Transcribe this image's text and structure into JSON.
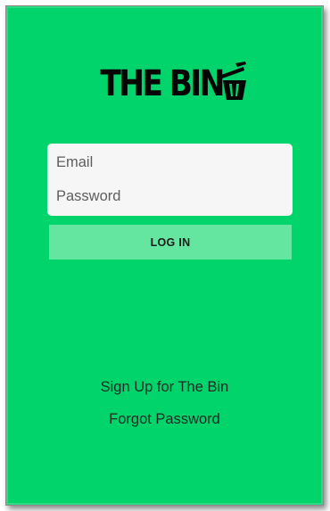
{
  "logo": {
    "text": "THE BIN",
    "icon": "trash-bin-icon"
  },
  "login_form": {
    "email_placeholder": "Email",
    "email_value": "",
    "password_placeholder": "Password",
    "password_value": ""
  },
  "actions": {
    "login_label": "LOG IN",
    "signup_label": "Sign Up for The Bin",
    "forgot_label": "Forgot Password"
  },
  "colors": {
    "background": "#00d46a",
    "card": "#f6f6f6",
    "button": "#64e6a0",
    "logo": "#050505"
  }
}
